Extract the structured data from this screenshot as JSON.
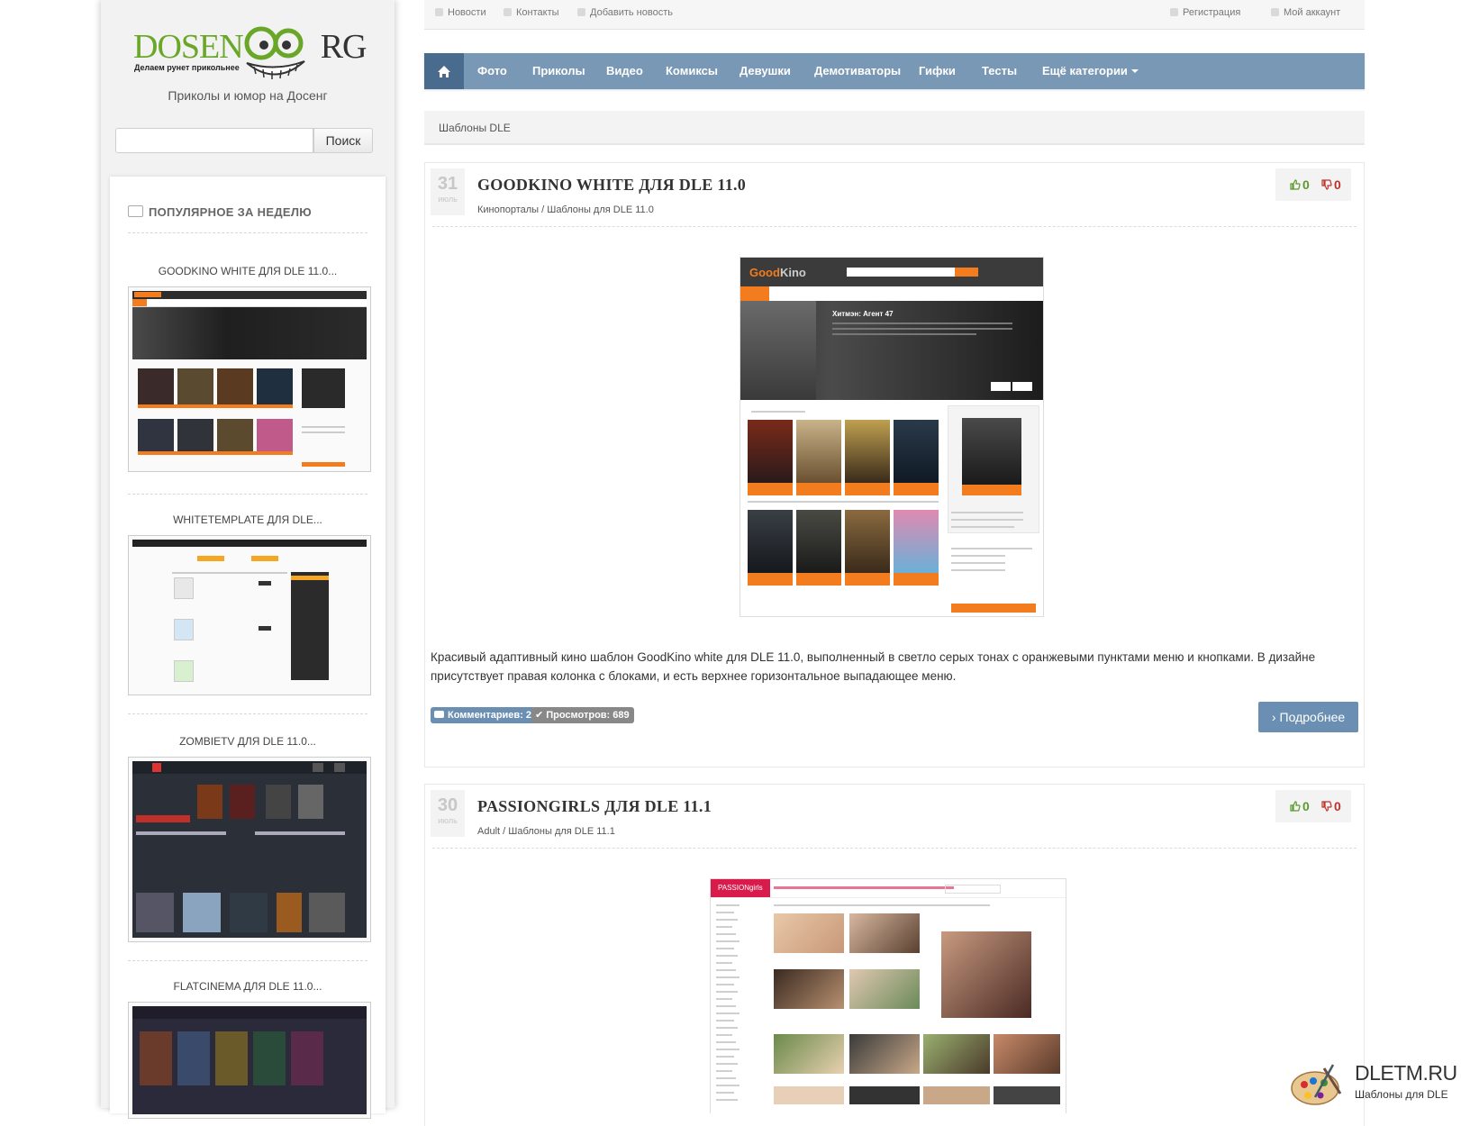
{
  "sidebar": {
    "logo_text_left": "DOSEN",
    "logo_text_right": "RG",
    "logo_slogan": "Делаем рунет прикольнее",
    "tagline": "Приколы и юмор на Досенг",
    "search_placeholder": "",
    "search_button": "Поиск",
    "popular_title": "ПОПУЛЯРНОЕ ЗА НЕДЕЛЮ",
    "popular_items": [
      {
        "title": "GOODKINO WHITE ДЛЯ DLE 11.0..."
      },
      {
        "title": "WHITETEMPLATE ДЛЯ DLE..."
      },
      {
        "title": "ZOMBIETV ДЛЯ DLE 11.0..."
      },
      {
        "title": "FLATCINEMA ДЛЯ DLE 11.0..."
      }
    ]
  },
  "topbar": {
    "left": [
      "Новости",
      "Контакты",
      "Добавить новость"
    ],
    "right": [
      "Регистрация",
      "Мой аккаунт"
    ]
  },
  "nav": {
    "items": [
      "Фото",
      "Приколы",
      "Видео",
      "Комиксы",
      "Девушки",
      "Демотиваторы",
      "Гифки",
      "Тесты",
      "Ещё категории"
    ]
  },
  "breadcrumb": "Шаблоны DLE",
  "articles": [
    {
      "day": "31",
      "month": "июль",
      "title": "GOODKINO WHITE ДЛЯ DLE 11.0",
      "cat1": "Кинопорталы",
      "cat2": "Шаблоны для DLE 11.0",
      "likes": "0",
      "dislikes": "0",
      "preview_logo": "Good",
      "preview_logo2": "Kino",
      "preview_hero": "Хитмэн: Агент 47",
      "description": "Красивый адаптивный кино шаблон GoodKino white для DLE 11.0, выполненный в светло серых тонах с оранжевыми пунктами меню и кнопками. В дизайне присутствует правая колонка с блоками, и есть верхнее горизонтальное выпадающее меню.",
      "comments": "Комментариев: 2",
      "views": "Просмотров: 689",
      "more": "Подробнее"
    },
    {
      "day": "30",
      "month": "июль",
      "title": "PASSIONGIRLS ДЛЯ DLE 11.1",
      "cat1": "Adult",
      "cat2": "Шаблоны для DLE 11.1",
      "likes": "0",
      "dislikes": "0",
      "preview_logo": "PASSIONgirls"
    }
  ],
  "watermark": {
    "title": "DLETM.RU",
    "subtitle": "Шаблоны для DLE"
  },
  "colors": {
    "nav": "#7998b6",
    "nav_home": "#496b8e",
    "accent_orange": "#f27c1e",
    "like": "#5a9a2c",
    "dislike": "#c0302a",
    "badge": "#6a8fb2",
    "logo_green": "#6aa729"
  }
}
